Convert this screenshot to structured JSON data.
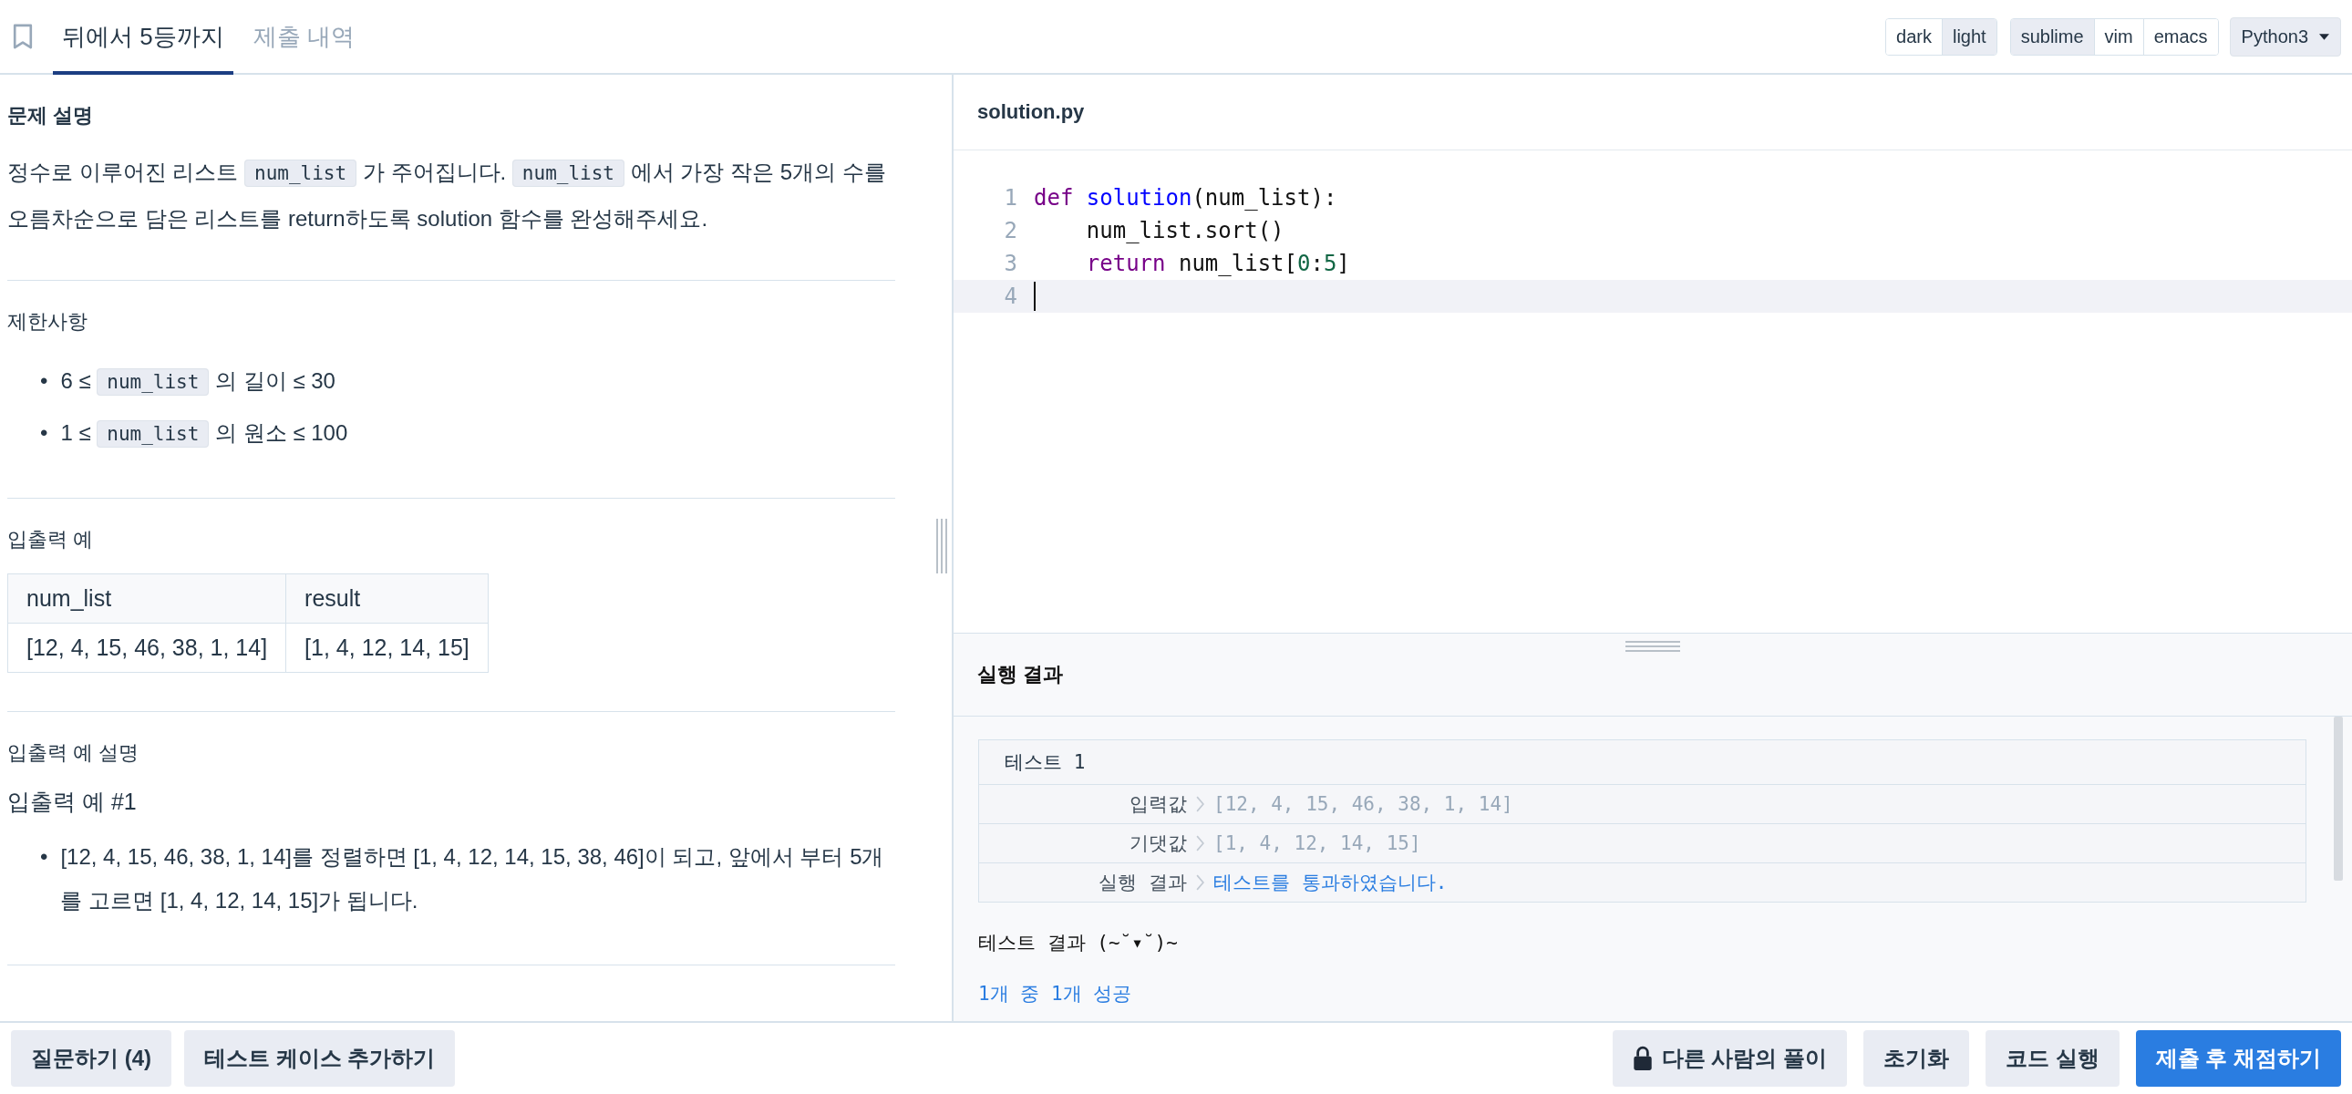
{
  "tabs": [
    {
      "label": "뒤에서 5등까지",
      "selected": true
    },
    {
      "label": "제출 내역",
      "selected": false
    }
  ],
  "theme_options": [
    {
      "label": "dark",
      "selected": false
    },
    {
      "label": "light",
      "selected": true
    }
  ],
  "keymap_options": [
    {
      "label": "sublime",
      "selected": true
    },
    {
      "label": "vim",
      "selected": false
    },
    {
      "label": "emacs",
      "selected": false
    }
  ],
  "language": "Python3",
  "problem": {
    "sections": [
      {
        "kind": "description",
        "title": "문제 설명",
        "paragraphs": [
          [
            {
              "kind": "text",
              "text": "정수로 이루어진 리스트 "
            },
            {
              "kind": "code",
              "text": "num_list"
            },
            {
              "kind": "text",
              "text": " 가 주어집니다. "
            },
            {
              "kind": "code",
              "text": "num_list"
            },
            {
              "kind": "text",
              "text": " 에서 가장 작은 5개의 수를 오름차순으로 담은 리스트를 return하도록 solution 함수를 완성해주세요."
            }
          ]
        ]
      },
      {
        "kind": "constraints",
        "title": "제한사항",
        "items": [
          {
            "marker": "•",
            "parts": [
              {
                "kind": "text",
                "text": "6 ≤ "
              },
              {
                "kind": "code",
                "text": "num_list"
              },
              {
                "kind": "text",
                "text": " 의 길이 ≤ 30"
              }
            ]
          },
          {
            "marker": "•",
            "parts": [
              {
                "kind": "text",
                "text": "1 ≤ "
              },
              {
                "kind": "code",
                "text": "num_list"
              },
              {
                "kind": "text",
                "text": " 의 원소 ≤ 100"
              }
            ]
          }
        ]
      },
      {
        "kind": "examples",
        "title": "입출력 예",
        "table": {
          "columns": [
            "num_list",
            "result"
          ],
          "rows": [
            [
              "[12, 4, 15, 46, 38, 1, 14]",
              "[1, 4, 12, 14, 15]"
            ]
          ]
        }
      },
      {
        "kind": "explanation",
        "title": "입출력 예 설명",
        "subtitle": "입출력 예 #1",
        "items": [
          {
            "marker": "•",
            "parts": [
              {
                "kind": "text",
                "text": "[12, 4, 15, 46, 38, 1, 14]를 정렬하면 [1, 4, 12, 14, 15, 38, 46]이 되고, 앞에서 부터 5개를 고르면 [1, 4, 12, 14, 15]가 됩니다."
              }
            ]
          }
        ]
      }
    ]
  },
  "editor": {
    "filename": "solution.py",
    "lines": [
      {
        "number": "1",
        "active": false,
        "tokens": [
          {
            "kind": "keyword",
            "text": "def "
          },
          {
            "kind": "function",
            "text": "solution"
          },
          {
            "kind": "plain",
            "text": "(num_list):"
          }
        ]
      },
      {
        "number": "2",
        "active": false,
        "tokens": [
          {
            "kind": "plain",
            "text": "    num_list.sort()"
          }
        ]
      },
      {
        "number": "3",
        "active": false,
        "tokens": [
          {
            "kind": "keyword",
            "text": "    return"
          },
          {
            "kind": "plain",
            "text": " num_list["
          },
          {
            "kind": "number",
            "text": "0"
          },
          {
            "kind": "plain",
            "text": ":"
          },
          {
            "kind": "number",
            "text": "5"
          },
          {
            "kind": "plain",
            "text": "]"
          }
        ]
      },
      {
        "number": "4",
        "active": true
      }
    ]
  },
  "result": {
    "title": "실행 결과",
    "test": {
      "title": "테스트 1",
      "rows": [
        {
          "label": "입력값",
          "value": "[12, 4, 15, 46, 38, 1, 14]",
          "kind": "muted"
        },
        {
          "label": "기댓값",
          "value": "[1, 4, 12, 14, 15]",
          "kind": "muted"
        },
        {
          "label": "실행 결과",
          "value": "테스트를 통과하였습니다.",
          "kind": "pass"
        }
      ]
    },
    "summary_title": "테스트 결과 (~˘▾˘)~",
    "summary": "1개 중 1개 성공"
  },
  "left_buttons": [
    {
      "label": "질문하기 (4)",
      "kind": "secondary"
    },
    {
      "label": "테스트 케이스 추가하기",
      "kind": "secondary"
    }
  ],
  "right_buttons": [
    {
      "label": "다른 사람의 풀이",
      "kind": "secondary"
    },
    {
      "label": "초기화",
      "kind": "secondary"
    },
    {
      "label": "코드 실행",
      "kind": "secondary"
    },
    {
      "label": "제출 후 채점하기",
      "kind": "primary"
    }
  ]
}
